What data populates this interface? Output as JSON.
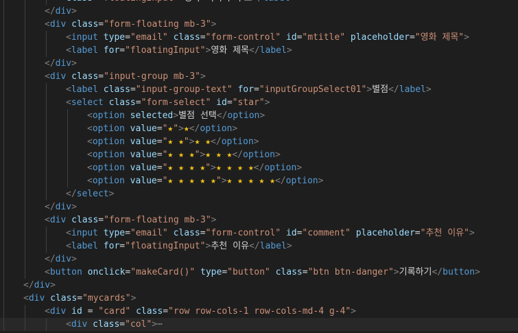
{
  "editor": {
    "colors": {
      "background": "#1e1e1e",
      "current_line": "#282828",
      "indent_guide": "#404040",
      "punctuation": "#808080",
      "tag": "#569cd6",
      "attribute": "#9cdcfe",
      "string": "#ce9178",
      "text": "#d4d4d4",
      "star_glyph": "#f5c518"
    },
    "lines": [
      {
        "indent": 3,
        "tokens": [
          [
            "attr",
            "class"
          ],
          [
            "text",
            "="
          ],
          [
            "string",
            "\"floatingInput\""
          ],
          [
            "punct",
            ">"
          ],
          [
            "text",
            "영화 이미지 주소"
          ],
          [
            "punct",
            "</"
          ],
          [
            "tag",
            "label"
          ],
          [
            "punct",
            ">"
          ]
        ]
      },
      {
        "indent": 2,
        "tokens": [
          [
            "punct",
            "</"
          ],
          [
            "tag",
            "div"
          ],
          [
            "punct",
            ">"
          ]
        ]
      },
      {
        "indent": 2,
        "tokens": [
          [
            "punct",
            "<"
          ],
          [
            "tag",
            "div"
          ],
          [
            "text",
            " "
          ],
          [
            "attr",
            "class"
          ],
          [
            "text",
            "="
          ],
          [
            "string",
            "\"form-floating mb-3\""
          ],
          [
            "punct",
            ">"
          ]
        ]
      },
      {
        "indent": 3,
        "tokens": [
          [
            "punct",
            "<"
          ],
          [
            "tag",
            "input"
          ],
          [
            "text",
            " "
          ],
          [
            "attr",
            "type"
          ],
          [
            "text",
            "="
          ],
          [
            "string",
            "\"email\""
          ],
          [
            "text",
            " "
          ],
          [
            "attr",
            "class"
          ],
          [
            "text",
            "="
          ],
          [
            "string",
            "\"form-control\""
          ],
          [
            "text",
            " "
          ],
          [
            "attr",
            "id"
          ],
          [
            "text",
            "="
          ],
          [
            "string",
            "\"mtitle\""
          ],
          [
            "text",
            " "
          ],
          [
            "attr",
            "placeholder"
          ],
          [
            "text",
            "="
          ],
          [
            "string",
            "\"영화 제목\""
          ],
          [
            "punct",
            ">"
          ]
        ]
      },
      {
        "indent": 3,
        "tokens": [
          [
            "punct",
            "<"
          ],
          [
            "tag",
            "label"
          ],
          [
            "text",
            " "
          ],
          [
            "attr",
            "for"
          ],
          [
            "text",
            "="
          ],
          [
            "string",
            "\"floatingInput\""
          ],
          [
            "punct",
            ">"
          ],
          [
            "text",
            "영화 제목"
          ],
          [
            "punct",
            "</"
          ],
          [
            "tag",
            "label"
          ],
          [
            "punct",
            ">"
          ]
        ]
      },
      {
        "indent": 2,
        "tokens": [
          [
            "punct",
            "</"
          ],
          [
            "tag",
            "div"
          ],
          [
            "punct",
            ">"
          ]
        ]
      },
      {
        "indent": 2,
        "tokens": [
          [
            "punct",
            "<"
          ],
          [
            "tag",
            "div"
          ],
          [
            "text",
            " "
          ],
          [
            "attr",
            "class"
          ],
          [
            "text",
            "="
          ],
          [
            "string",
            "\"input-group mb-3\""
          ],
          [
            "punct",
            ">"
          ]
        ]
      },
      {
        "indent": 3,
        "tokens": [
          [
            "punct",
            "<"
          ],
          [
            "tag",
            "label"
          ],
          [
            "text",
            " "
          ],
          [
            "attr",
            "class"
          ],
          [
            "text",
            "="
          ],
          [
            "string",
            "\"input-group-text\""
          ],
          [
            "text",
            " "
          ],
          [
            "attr",
            "for"
          ],
          [
            "text",
            "="
          ],
          [
            "string",
            "\"inputGroupSelect01\""
          ],
          [
            "punct",
            ">"
          ],
          [
            "text",
            "별점"
          ],
          [
            "punct",
            "</"
          ],
          [
            "tag",
            "label"
          ],
          [
            "punct",
            ">"
          ]
        ]
      },
      {
        "indent": 3,
        "tokens": [
          [
            "punct",
            "<"
          ],
          [
            "tag",
            "select"
          ],
          [
            "text",
            " "
          ],
          [
            "attr",
            "class"
          ],
          [
            "text",
            "="
          ],
          [
            "string",
            "\"form-select\""
          ],
          [
            "text",
            " "
          ],
          [
            "attr",
            "id"
          ],
          [
            "text",
            "="
          ],
          [
            "string",
            "\"star\""
          ],
          [
            "punct",
            ">"
          ]
        ]
      },
      {
        "indent": 4,
        "tokens": [
          [
            "punct",
            "<"
          ],
          [
            "tag",
            "option"
          ],
          [
            "text",
            " "
          ],
          [
            "attr",
            "selected"
          ],
          [
            "punct",
            ">"
          ],
          [
            "text",
            "별점 선택"
          ],
          [
            "punct",
            "</"
          ],
          [
            "tag",
            "option"
          ],
          [
            "punct",
            ">"
          ]
        ]
      },
      {
        "indent": 4,
        "tokens": [
          [
            "punct",
            "<"
          ],
          [
            "tag",
            "option"
          ],
          [
            "text",
            " "
          ],
          [
            "attr",
            "value"
          ],
          [
            "text",
            "="
          ],
          [
            "string",
            "\""
          ],
          [
            "star",
            "★"
          ],
          [
            "string",
            "\""
          ],
          [
            "punct",
            ">"
          ],
          [
            "star",
            "★"
          ],
          [
            "punct",
            "</"
          ],
          [
            "tag",
            "option"
          ],
          [
            "punct",
            ">"
          ]
        ]
      },
      {
        "indent": 4,
        "tokens": [
          [
            "punct",
            "<"
          ],
          [
            "tag",
            "option"
          ],
          [
            "text",
            " "
          ],
          [
            "attr",
            "value"
          ],
          [
            "text",
            "="
          ],
          [
            "string",
            "\""
          ],
          [
            "star",
            "★ ★"
          ],
          [
            "string",
            "\""
          ],
          [
            "punct",
            ">"
          ],
          [
            "star",
            "★ ★"
          ],
          [
            "punct",
            "</"
          ],
          [
            "tag",
            "option"
          ],
          [
            "punct",
            ">"
          ]
        ]
      },
      {
        "indent": 4,
        "tokens": [
          [
            "punct",
            "<"
          ],
          [
            "tag",
            "option"
          ],
          [
            "text",
            " "
          ],
          [
            "attr",
            "value"
          ],
          [
            "text",
            "="
          ],
          [
            "string",
            "\""
          ],
          [
            "star",
            "★ ★ ★"
          ],
          [
            "string",
            "\""
          ],
          [
            "punct",
            ">"
          ],
          [
            "star",
            "★ ★ ★"
          ],
          [
            "punct",
            "</"
          ],
          [
            "tag",
            "option"
          ],
          [
            "punct",
            ">"
          ]
        ]
      },
      {
        "indent": 4,
        "tokens": [
          [
            "punct",
            "<"
          ],
          [
            "tag",
            "option"
          ],
          [
            "text",
            " "
          ],
          [
            "attr",
            "value"
          ],
          [
            "text",
            "="
          ],
          [
            "string",
            "\""
          ],
          [
            "star",
            "★ ★ ★ ★"
          ],
          [
            "string",
            "\""
          ],
          [
            "punct",
            ">"
          ],
          [
            "star",
            "★ ★ ★ ★"
          ],
          [
            "punct",
            "</"
          ],
          [
            "tag",
            "option"
          ],
          [
            "punct",
            ">"
          ]
        ]
      },
      {
        "indent": 4,
        "tokens": [
          [
            "punct",
            "<"
          ],
          [
            "tag",
            "option"
          ],
          [
            "text",
            " "
          ],
          [
            "attr",
            "value"
          ],
          [
            "text",
            "="
          ],
          [
            "string",
            "\""
          ],
          [
            "star",
            "★ ★ ★ ★ ★"
          ],
          [
            "string",
            "\""
          ],
          [
            "punct",
            ">"
          ],
          [
            "star",
            "★ ★ ★ ★ ★"
          ],
          [
            "punct",
            "</"
          ],
          [
            "tag",
            "option"
          ],
          [
            "punct",
            ">"
          ]
        ]
      },
      {
        "indent": 3,
        "tokens": [
          [
            "punct",
            "</"
          ],
          [
            "tag",
            "select"
          ],
          [
            "punct",
            ">"
          ]
        ]
      },
      {
        "indent": 2,
        "tokens": [
          [
            "punct",
            "</"
          ],
          [
            "tag",
            "div"
          ],
          [
            "punct",
            ">"
          ]
        ]
      },
      {
        "indent": 2,
        "tokens": [
          [
            "punct",
            "<"
          ],
          [
            "tag",
            "div"
          ],
          [
            "text",
            " "
          ],
          [
            "attr",
            "class"
          ],
          [
            "text",
            "="
          ],
          [
            "string",
            "\"form-floating mb-3\""
          ],
          [
            "punct",
            ">"
          ]
        ]
      },
      {
        "indent": 3,
        "tokens": [
          [
            "punct",
            "<"
          ],
          [
            "tag",
            "input"
          ],
          [
            "text",
            " "
          ],
          [
            "attr",
            "type"
          ],
          [
            "text",
            "="
          ],
          [
            "string",
            "\"email\""
          ],
          [
            "text",
            " "
          ],
          [
            "attr",
            "class"
          ],
          [
            "text",
            "="
          ],
          [
            "string",
            "\"form-control\""
          ],
          [
            "text",
            " "
          ],
          [
            "attr",
            "id"
          ],
          [
            "text",
            "="
          ],
          [
            "string",
            "\"comment\""
          ],
          [
            "text",
            " "
          ],
          [
            "attr",
            "placeholder"
          ],
          [
            "text",
            "="
          ],
          [
            "string",
            "\"추천 이유\""
          ],
          [
            "punct",
            ">"
          ]
        ]
      },
      {
        "indent": 3,
        "tokens": [
          [
            "punct",
            "<"
          ],
          [
            "tag",
            "label"
          ],
          [
            "text",
            " "
          ],
          [
            "attr",
            "for"
          ],
          [
            "text",
            "="
          ],
          [
            "string",
            "\"floatingInput\""
          ],
          [
            "punct",
            ">"
          ],
          [
            "text",
            "추천 이유"
          ],
          [
            "punct",
            "</"
          ],
          [
            "tag",
            "label"
          ],
          [
            "punct",
            ">"
          ]
        ]
      },
      {
        "indent": 2,
        "tokens": [
          [
            "punct",
            "</"
          ],
          [
            "tag",
            "div"
          ],
          [
            "punct",
            ">"
          ]
        ]
      },
      {
        "indent": 2,
        "tokens": [
          [
            "punct",
            "<"
          ],
          [
            "tag",
            "button"
          ],
          [
            "text",
            " "
          ],
          [
            "attr",
            "onclick"
          ],
          [
            "text",
            "="
          ],
          [
            "string",
            "\"makeCard()\""
          ],
          [
            "text",
            " "
          ],
          [
            "attr",
            "type"
          ],
          [
            "text",
            "="
          ],
          [
            "string",
            "\"button\""
          ],
          [
            "text",
            " "
          ],
          [
            "attr",
            "class"
          ],
          [
            "text",
            "="
          ],
          [
            "string",
            "\"btn btn-danger\""
          ],
          [
            "punct",
            ">"
          ],
          [
            "text",
            "기록하기"
          ],
          [
            "punct",
            "</"
          ],
          [
            "tag",
            "button"
          ],
          [
            "punct",
            ">"
          ]
        ]
      },
      {
        "indent": 1,
        "tokens": [
          [
            "punct",
            "</"
          ],
          [
            "tag",
            "div"
          ],
          [
            "punct",
            ">"
          ]
        ]
      },
      {
        "indent": 1,
        "tokens": [
          [
            "punct",
            "<"
          ],
          [
            "tag",
            "div"
          ],
          [
            "text",
            " "
          ],
          [
            "attr",
            "class"
          ],
          [
            "text",
            "="
          ],
          [
            "string",
            "\"mycards\""
          ],
          [
            "punct",
            ">"
          ]
        ]
      },
      {
        "indent": 2,
        "tokens": [
          [
            "punct",
            "<"
          ],
          [
            "tag",
            "div"
          ],
          [
            "text",
            " "
          ],
          [
            "attr",
            "id"
          ],
          [
            "text",
            " = "
          ],
          [
            "string",
            "\"card\""
          ],
          [
            "text",
            " "
          ],
          [
            "attr",
            "class"
          ],
          [
            "text",
            "="
          ],
          [
            "string",
            "\"row row-cols-1 row-cols-md-4 g-4\""
          ],
          [
            "punct",
            ">"
          ]
        ]
      },
      {
        "indent": 3,
        "current": true,
        "tokens": [
          [
            "punct",
            "<"
          ],
          [
            "tag",
            "div"
          ],
          [
            "text",
            " "
          ],
          [
            "attr",
            "class"
          ],
          [
            "text",
            "="
          ],
          [
            "string",
            "\"col\""
          ],
          [
            "punct",
            ">"
          ],
          [
            "fold",
            "⋯"
          ]
        ]
      }
    ]
  }
}
